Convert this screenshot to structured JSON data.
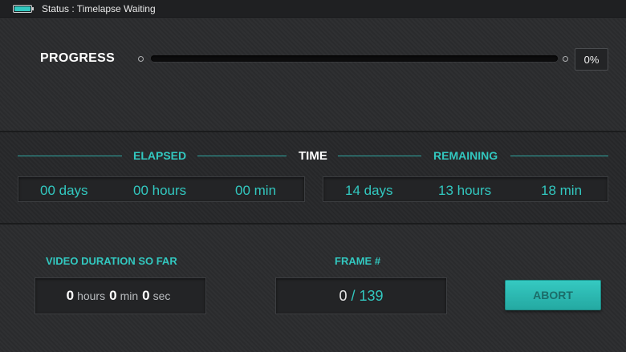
{
  "status_bar": {
    "battery_icon": "battery-icon",
    "status_text": "Status : Timelapse Waiting"
  },
  "progress": {
    "label": "PROGRESS",
    "value_percent": 0,
    "percent_text": "0%"
  },
  "time": {
    "elapsed_label": "ELAPSED",
    "center_label": "TIME",
    "remaining_label": "REMAINING",
    "elapsed": {
      "days": "00 days",
      "hours": "00 hours",
      "min": "00 min"
    },
    "remaining": {
      "days": "14 days",
      "hours": "13 hours",
      "min": "18 min"
    }
  },
  "video_duration": {
    "label": "VIDEO DURATION SO FAR",
    "hours_value": "0",
    "hours_unit": "hours",
    "min_value": "0",
    "min_unit": "min",
    "sec_value": "0",
    "sec_unit": "sec"
  },
  "frame": {
    "label": "FRAME #",
    "current": "0",
    "total": "/ 139"
  },
  "abort_label": "ABORT",
  "colors": {
    "accent": "#32c8c0",
    "background": "#2a2b2d",
    "top_bar": "#1f2022"
  }
}
